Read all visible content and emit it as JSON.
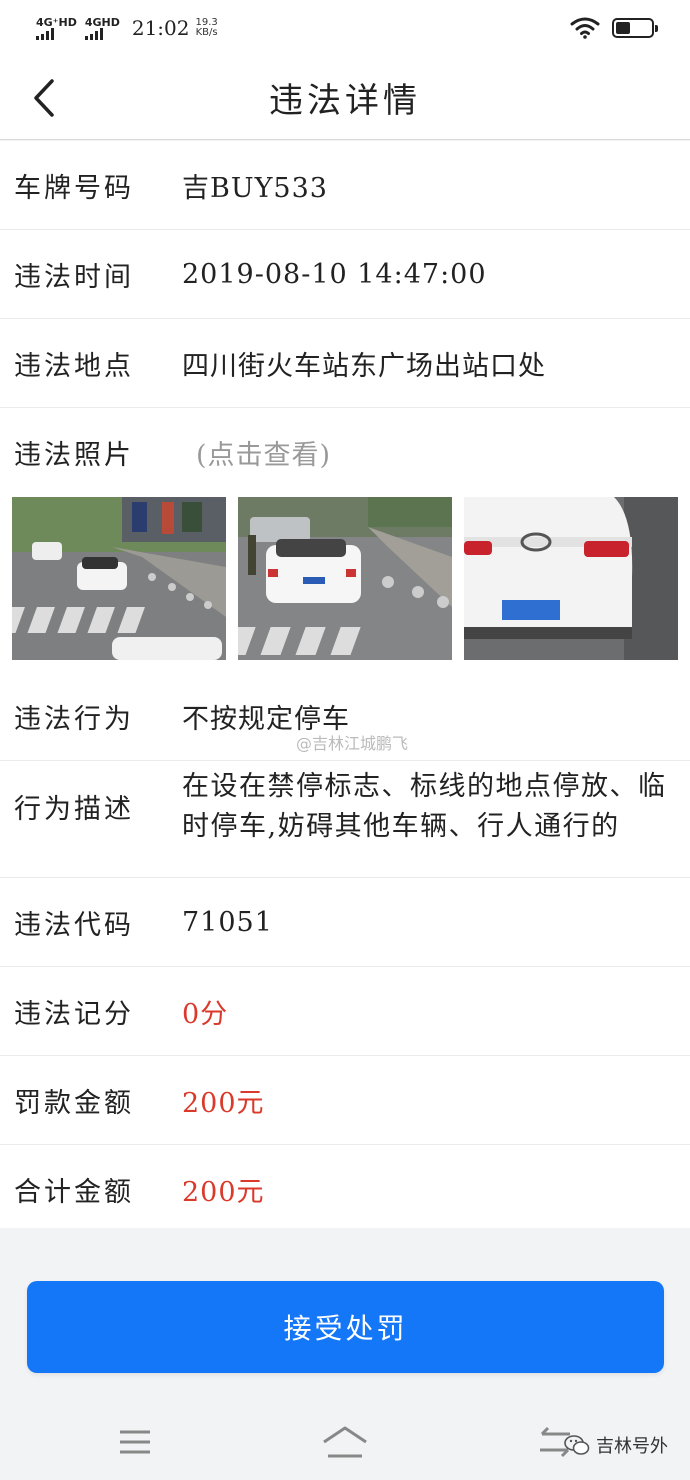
{
  "status_bar": {
    "network1": "4G⁺HD",
    "network2": "4GHD",
    "time": "21:02",
    "speed_value": "19.3",
    "speed_unit": "KB/s"
  },
  "header": {
    "title": "违法详情"
  },
  "fields": {
    "plate": {
      "label": "车牌号码",
      "value": "吉BUY533"
    },
    "time": {
      "label": "违法时间",
      "value": "2019-08-10 14:47:00"
    },
    "location": {
      "label": "违法地点",
      "value": "四川街火车站东广场出站口处"
    },
    "photos": {
      "label": "违法照片",
      "hint": "(点击查看)"
    },
    "behavior": {
      "label": "违法行为",
      "value": "不按规定停车"
    },
    "description": {
      "label": "行为描述",
      "value": "在设在禁停标志、标线的地点停放、临时停车,妨碍其他车辆、行人通行的"
    },
    "code": {
      "label": "违法代码",
      "value": "71051"
    },
    "points": {
      "label": "违法记分",
      "value": "0分"
    },
    "fine": {
      "label": "罚款金额",
      "value": "200元"
    },
    "total": {
      "label": "合计金额",
      "value": "200元"
    }
  },
  "watermark": "@吉林江城鹏飞",
  "accept_button": "接受处罚",
  "channel_badge": "吉林号外",
  "colors": {
    "accent": "#1477f8",
    "amount_red": "#d93a2b"
  },
  "icons": [
    "back-chevron-icon",
    "wifi-icon",
    "battery-icon",
    "menu-icon",
    "home-icon",
    "back-switch-icon",
    "wechat-icon"
  ]
}
